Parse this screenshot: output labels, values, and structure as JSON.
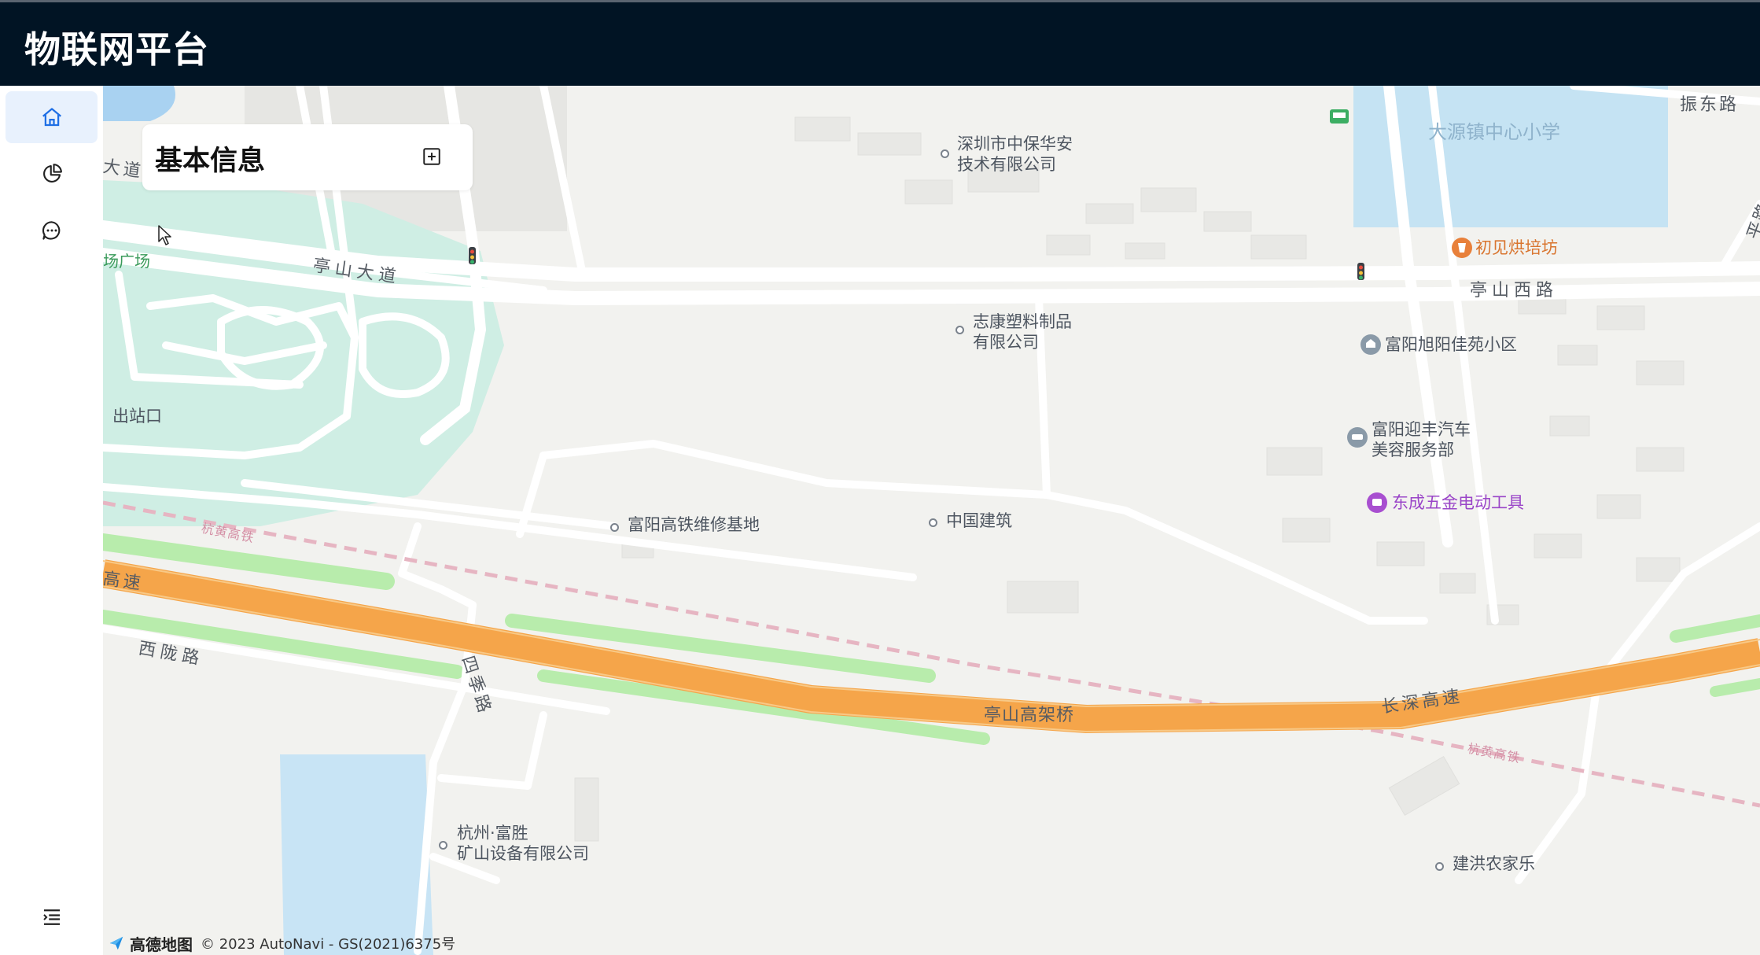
{
  "header": {
    "title": "物联网平台"
  },
  "sidebar": {
    "items": [
      {
        "icon": "home-icon",
        "active": true
      },
      {
        "icon": "pie-chart-icon",
        "active": false
      },
      {
        "icon": "chat-icon",
        "active": false
      }
    ],
    "bottom_icon": "collapse-menu-icon"
  },
  "panel": {
    "title": "基本信息",
    "expand_icon": "expand-square-icon"
  },
  "map": {
    "pois": {
      "p1": "深圳市中保华安",
      "p1b": "技术有限公司",
      "p2": "志康塑料制品",
      "p2b": "有限公司",
      "p3": "富阳高铁维修基地",
      "p4": "中国建筑",
      "p5": "杭州·富胜",
      "p5b": "矿山设备有限公司",
      "p6": "建洪农家乐",
      "p7": "初见烘培坊",
      "p8": "富阳旭阳佳苑小区",
      "p9": "富阳迎丰汽车",
      "p9b": "美容服务部",
      "p10": "东成五金电动工具",
      "p11": "大源镇中心小学",
      "p12": "出站口",
      "p13": "场广场"
    },
    "roads": {
      "r1": "亭山大道",
      "r2": "亭山西路",
      "r3": "振东路",
      "r4": "西陇路",
      "r5": "四季路",
      "r6": "亭山高架桥",
      "r7": "长深高速",
      "r8": "高速",
      "r9": "杭黄高铁",
      "r10": "杭黄高铁",
      "r11": "大道",
      "r12": "平路"
    }
  },
  "attribution": {
    "logo": "高德地图",
    "text": "© 2023 AutoNavi - GS(2021)6375号"
  },
  "colors": {
    "header_bg": "#011424",
    "active_nav": "#e8f1fd",
    "highway": "#f5a54a",
    "park": "#cfeee4",
    "water": "#c8e4f5",
    "accent": "#1f6fe5"
  }
}
